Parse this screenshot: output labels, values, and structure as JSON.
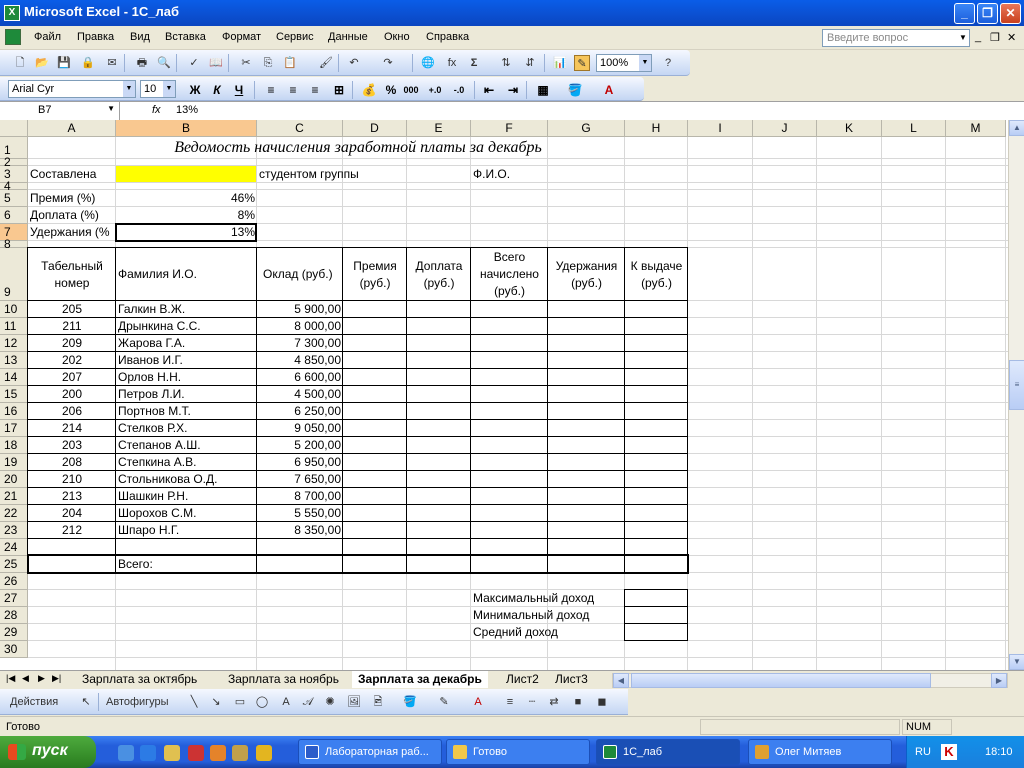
{
  "window": {
    "title": "Microsoft Excel - 1С_лаб",
    "app_icon_letter": "X"
  },
  "menu": {
    "items": [
      "Файл",
      "Правка",
      "Вид",
      "Вставка",
      "Формат",
      "Сервис",
      "Данные",
      "Окно",
      "Справка"
    ],
    "help_placeholder": "Введите вопрос"
  },
  "toolbar": {
    "zoom": "100%",
    "font_name": "Arial Cyr",
    "font_size": "10",
    "bold": "Ж",
    "italic": "К",
    "underline": "Ч",
    "percent": "%",
    "thousands": "000",
    "fx": "fx",
    "sigma": "Σ"
  },
  "formula_bar": {
    "name_box": "B7",
    "fx_label": "fx",
    "content": "13%"
  },
  "columns": [
    "A",
    "B",
    "C",
    "D",
    "E",
    "F",
    "G",
    "H",
    "I",
    "J",
    "K",
    "L",
    "M"
  ],
  "rows": [
    "1",
    "2",
    "3",
    "4",
    "5",
    "6",
    "7",
    "8",
    "9",
    "10",
    "11",
    "12",
    "13",
    "14",
    "15",
    "16",
    "17",
    "18",
    "19",
    "20",
    "21",
    "22",
    "23",
    "24",
    "25",
    "26",
    "27",
    "28",
    "29",
    "30"
  ],
  "sheet": {
    "title": "Ведомость начисления заработной платы за декабрь",
    "composed_label": "Составлена",
    "group_label": "студентом группы",
    "fio_label": "Ф.И.О.",
    "params": [
      {
        "label": "Премия (%)",
        "value": "46%"
      },
      {
        "label": "Доплата (%)",
        "value": "8%"
      },
      {
        "label": "Удержания (%",
        "value": "13%"
      }
    ],
    "headers": {
      "tab_no": [
        "Табельный",
        "номер"
      ],
      "name": "Фамилия И.О.",
      "salary": "Оклад (руб.)",
      "bonus": [
        "Премия",
        "(руб.)"
      ],
      "extra": [
        "Доплата",
        "(руб.)"
      ],
      "total": [
        "Всего",
        "начислено",
        "(руб.)"
      ],
      "deduction": [
        "Удержания",
        "(руб.)"
      ],
      "payout": [
        "К выдаче",
        "(руб.)"
      ]
    },
    "employees": [
      {
        "id": "205",
        "name": "Галкин В.Ж.",
        "salary": "5 900,00"
      },
      {
        "id": "211",
        "name": "Дрынкина С.С.",
        "salary": "8 000,00"
      },
      {
        "id": "209",
        "name": "Жарова Г.А.",
        "salary": "7 300,00"
      },
      {
        "id": "202",
        "name": "Иванов И.Г.",
        "salary": "4 850,00"
      },
      {
        "id": "207",
        "name": "Орлов Н.Н.",
        "salary": "6 600,00"
      },
      {
        "id": "200",
        "name": "Петров Л.И.",
        "salary": "4 500,00"
      },
      {
        "id": "206",
        "name": "Портнов М.Т.",
        "salary": "6 250,00"
      },
      {
        "id": "214",
        "name": "Стелков Р.Х.",
        "salary": "9 050,00"
      },
      {
        "id": "203",
        "name": "Степанов А.Ш.",
        "salary": "5 200,00"
      },
      {
        "id": "208",
        "name": "Степкина А.В.",
        "salary": "6 950,00"
      },
      {
        "id": "210",
        "name": "Стольникова О.Д.",
        "salary": "7 650,00"
      },
      {
        "id": "213",
        "name": "Шашкин Р.Н.",
        "salary": "8 700,00"
      },
      {
        "id": "204",
        "name": "Шорохов С.М.",
        "salary": "5 550,00"
      },
      {
        "id": "212",
        "name": "Шпаро Н.Г.",
        "salary": "8 350,00"
      }
    ],
    "total_label": "Всего:",
    "summary": [
      "Максимальный доход",
      "Минимальный доход",
      "Средний доход"
    ]
  },
  "sheet_tabs": {
    "tabs": [
      "Зарплата за октябрь",
      "Зарплата за ноябрь",
      "Зарплата за декабрь",
      "Лист2",
      "Лист3"
    ],
    "active": "Зарплата за декабрь"
  },
  "draw_toolbar": {
    "actions": "Действия",
    "autoshapes": "Автофигуры"
  },
  "status": {
    "text": "Готово",
    "num": "NUM"
  },
  "taskbar": {
    "start": "пуск",
    "tasks": [
      "Лабораторная раб...",
      "Готово",
      "1С_лаб",
      "Олег Митяев"
    ],
    "lang": "RU",
    "clock": "18:10"
  },
  "colors": {
    "selected_header": "#f9c890",
    "highlight_yellow": "#ffff00",
    "titlebar": "#0a5de8",
    "taskbar": "#245edb",
    "start": "#378f2a"
  }
}
